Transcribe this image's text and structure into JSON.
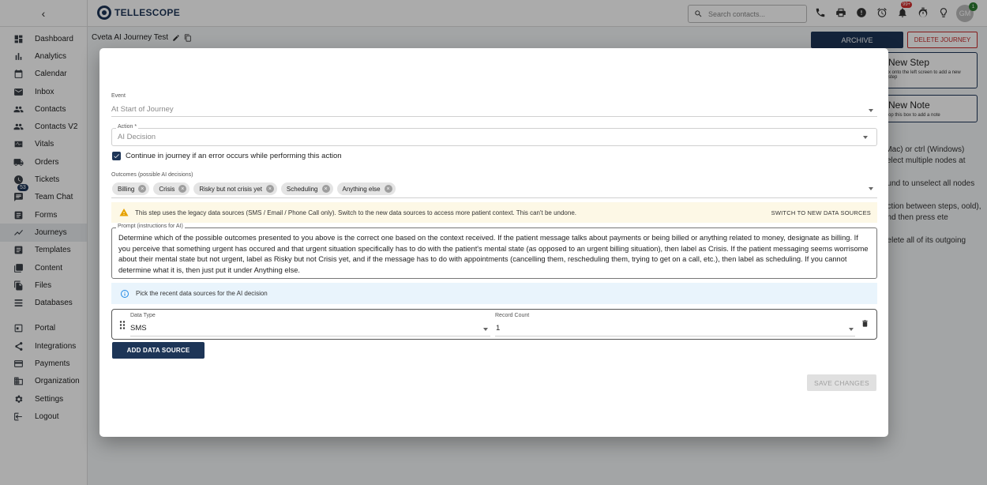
{
  "sidebar": {
    "collapse_glyph": "‹",
    "items": [
      {
        "label": "Dashboard",
        "icon": "dashboard-icon"
      },
      {
        "label": "Analytics",
        "icon": "analytics-icon"
      },
      {
        "label": "Calendar",
        "icon": "calendar-icon"
      },
      {
        "label": "Inbox",
        "icon": "inbox-icon"
      },
      {
        "label": "Contacts",
        "icon": "contacts-icon"
      },
      {
        "label": "Contacts V2",
        "icon": "contacts-icon"
      },
      {
        "label": "Vitals",
        "icon": "vitals-icon"
      },
      {
        "label": "Orders",
        "icon": "truck-icon"
      },
      {
        "label": "Tickets",
        "icon": "clock-icon"
      },
      {
        "label": "Team Chat",
        "icon": "chat-icon",
        "badge": "53"
      },
      {
        "label": "Forms",
        "icon": "forms-icon"
      },
      {
        "label": "Journeys",
        "icon": "journeys-icon"
      },
      {
        "label": "Templates",
        "icon": "templates-icon"
      },
      {
        "label": "Content",
        "icon": "content-icon"
      },
      {
        "label": "Files",
        "icon": "files-icon"
      },
      {
        "label": "Databases",
        "icon": "database-icon"
      },
      {
        "label": "Portal",
        "icon": "portal-icon"
      },
      {
        "label": "Integrations",
        "icon": "share-icon"
      },
      {
        "label": "Payments",
        "icon": "payments-icon"
      },
      {
        "label": "Organization",
        "icon": "organization-icon"
      },
      {
        "label": "Settings",
        "icon": "gear-icon"
      },
      {
        "label": "Logout",
        "icon": "logout-icon"
      }
    ]
  },
  "header": {
    "brand": "TELLESCOPE",
    "search_placeholder": "Search contacts...",
    "notifications_badge": "99+",
    "avatar_initials": "GM",
    "avatar_dot": "1"
  },
  "journey": {
    "title": "Cveta AI Journey Test",
    "archive_label": "ARCHIVE",
    "delete_label": "DELETE JOURNEY",
    "new_step_title": "New Step",
    "new_step_hint": "x onto the left screen to add a new step",
    "new_note_title": "New Note",
    "new_note_hint": "op this box to add a note",
    "help_lines": [
      "(Mac) or ctrl (Windows) select multiple nodes at",
      "ound to unselect all nodes",
      "ection between steps, oold), and then press ete",
      "delete all of its outgoing"
    ]
  },
  "modal": {
    "event_label": "Event",
    "event_value": "At Start of Journey",
    "action_label": "Action *",
    "action_value": "AI Decision",
    "continue_label": "Continue in journey if an error occurs while performing this action",
    "continue_checked": true,
    "outcomes_label": "Outcomes (possible AI decisions)",
    "outcomes": [
      "Billing",
      "Crisis",
      "Risky but not crisis yet",
      "Scheduling",
      "Anything else"
    ],
    "warning_text": "This step uses the legacy data sources (SMS / Email / Phone Call only). Switch to the new data sources to access more patient context. This can't be undone.",
    "warning_action": "SWITCH TO NEW DATA SOURCES",
    "prompt_label": "Prompt (instructions for AI)",
    "prompt_text": "Determine which of the possible outcomes presented to you above is the correct one based on the context received. If the patient message talks about payments or being billed or anything related to money, designate as billing. If you perceive that something urgent has occured and that urgent situation specifically has to do with the patient's mental state (as opposed to an urgent billing situation), then label as Crisis. If the patient messaging seems worrisome about their mental state but not urgent, label as Risky but not Crisis yet, and if the message has to do with appointments (cancelling them, rescheduling them, trying to get on a call, etc.), then label as scheduling. If you cannot determine what it is, then just put it under Anything else.",
    "info_text": "Pick the recent data sources for the AI decision",
    "data_type_label": "Data Type",
    "data_type_value": "SMS",
    "record_count_label": "Record Count",
    "record_count_value": "1",
    "add_source_label": "ADD DATA SOURCE",
    "save_label": "SAVE CHANGES"
  }
}
